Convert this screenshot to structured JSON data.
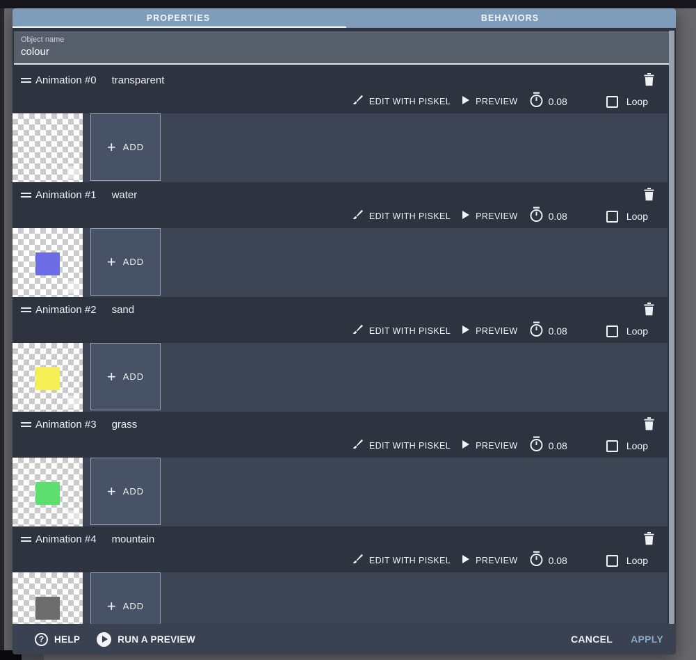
{
  "tab_bar": {
    "tabs": [
      {
        "label": "PROPERTIES",
        "active": true
      },
      {
        "label": "BEHAVIORS",
        "active": false
      }
    ]
  },
  "object_name": {
    "label": "Object name",
    "value": "colour"
  },
  "row_controls": {
    "edit_label": "EDIT WITH PISKEL",
    "preview_label": "PREVIEW",
    "loop_label": "Loop",
    "add_label": "ADD"
  },
  "icons": {
    "plus_glyph": "+",
    "help_glyph": "?"
  },
  "animations": [
    {
      "title": "Animation #0",
      "name": "transparent",
      "time": "0.08",
      "frame_color": "",
      "loop_checked": false
    },
    {
      "title": "Animation #1",
      "name": "water",
      "time": "0.08",
      "frame_color": "#6c6ce4",
      "loop_checked": false
    },
    {
      "title": "Animation #2",
      "name": "sand",
      "time": "0.08",
      "frame_color": "#f5ef55",
      "loop_checked": false
    },
    {
      "title": "Animation #3",
      "name": "grass",
      "time": "0.08",
      "frame_color": "#5cdf6d",
      "loop_checked": false
    },
    {
      "title": "Animation #4",
      "name": "mountain",
      "time": "0.08",
      "frame_color": "#6d6d6d",
      "loop_checked": false
    }
  ],
  "footer": {
    "help_label": "HELP",
    "run_label": "RUN A PREVIEW",
    "cancel_label": "CANCEL",
    "apply_label": "APPLY"
  },
  "colors": {
    "tab_bar_bg": "#7f9cba",
    "dialog_bg": "#2d333f",
    "frame_strip_bg": "#3d4554",
    "footer_bg": "#3a4150",
    "apply_text": "#87abc6"
  }
}
